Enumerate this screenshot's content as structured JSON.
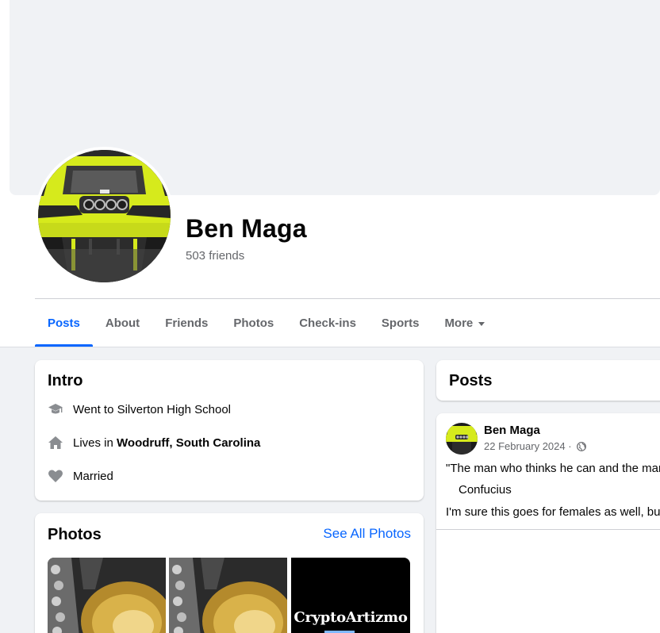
{
  "profile": {
    "name": "Ben Maga",
    "friends": "503 friends"
  },
  "tabs": [
    {
      "label": "Posts",
      "active": true
    },
    {
      "label": "About"
    },
    {
      "label": "Friends"
    },
    {
      "label": "Photos"
    },
    {
      "label": "Check-ins"
    },
    {
      "label": "Sports"
    },
    {
      "label": "More"
    }
  ],
  "intro": {
    "title": "Intro",
    "education": "Went to Silverton High School",
    "lives_prefix": "Lives in ",
    "lives_place": "Woodruff, South Carolina",
    "relationship": "Married"
  },
  "photos": {
    "title": "Photos",
    "see_all": "See All Photos",
    "watermark": "CryptoArtizmo"
  },
  "posts": {
    "title": "Posts",
    "post": {
      "author": "Ben Maga",
      "date": "22 February 2024 · ",
      "quote": "\"The man who thinks he can and the man",
      "attribution": "Confucius",
      "comment": "I'm sure this goes for females as well, but"
    }
  },
  "colors": {
    "accent": "#0866ff",
    "secondary_text": "#65676b",
    "page_bg": "#f0f2f5",
    "avatar_yellow": "#d6ea1c"
  },
  "icons": {
    "education": "graduation-cap-icon",
    "home": "house-icon",
    "relationship": "heart-icon",
    "privacy": "globe-icon",
    "more": "caret-down-icon"
  }
}
